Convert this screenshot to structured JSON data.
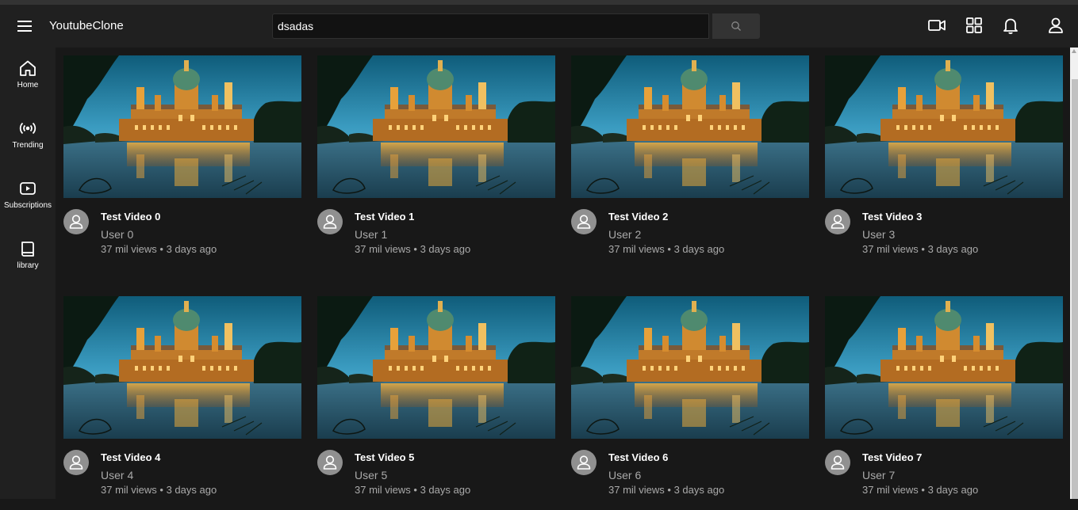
{
  "header": {
    "app_title": "YoutubeClone",
    "search_value": "dsadas",
    "icons": [
      "menu-icon",
      "search-icon",
      "video-camera-icon",
      "apps-grid-icon",
      "bell-icon",
      "account-icon"
    ]
  },
  "sidebar": {
    "items": [
      {
        "label": "Home",
        "icon": "home-icon"
      },
      {
        "label": "Trending",
        "icon": "trending-broadcast-icon"
      },
      {
        "label": "Subscriptions",
        "icon": "subscriptions-icon"
      },
      {
        "label": "library",
        "icon": "library-book-icon"
      }
    ]
  },
  "videos": [
    {
      "title": "Test Video 0",
      "user": "User 0",
      "meta": "37 mil views • 3 days ago"
    },
    {
      "title": "Test Video 1",
      "user": "User 1",
      "meta": "37 mil views • 3 days ago"
    },
    {
      "title": "Test Video 2",
      "user": "User 2",
      "meta": "37 mil views • 3 days ago"
    },
    {
      "title": "Test Video 3",
      "user": "User 3",
      "meta": "37 mil views • 3 days ago"
    },
    {
      "title": "Test Video 4",
      "user": "User 4",
      "meta": "37 mil views • 3 days ago"
    },
    {
      "title": "Test Video 5",
      "user": "User 5",
      "meta": "37 mil views • 3 days ago"
    },
    {
      "title": "Test Video 6",
      "user": "User 6",
      "meta": "37 mil views • 3 days ago"
    },
    {
      "title": "Test Video 7",
      "user": "User 7",
      "meta": "37 mil views • 3 days ago"
    }
  ],
  "colors": {
    "background": "#181818",
    "header": "#202020",
    "secondary_text": "#aaaaaa",
    "avatar": "#909090"
  }
}
